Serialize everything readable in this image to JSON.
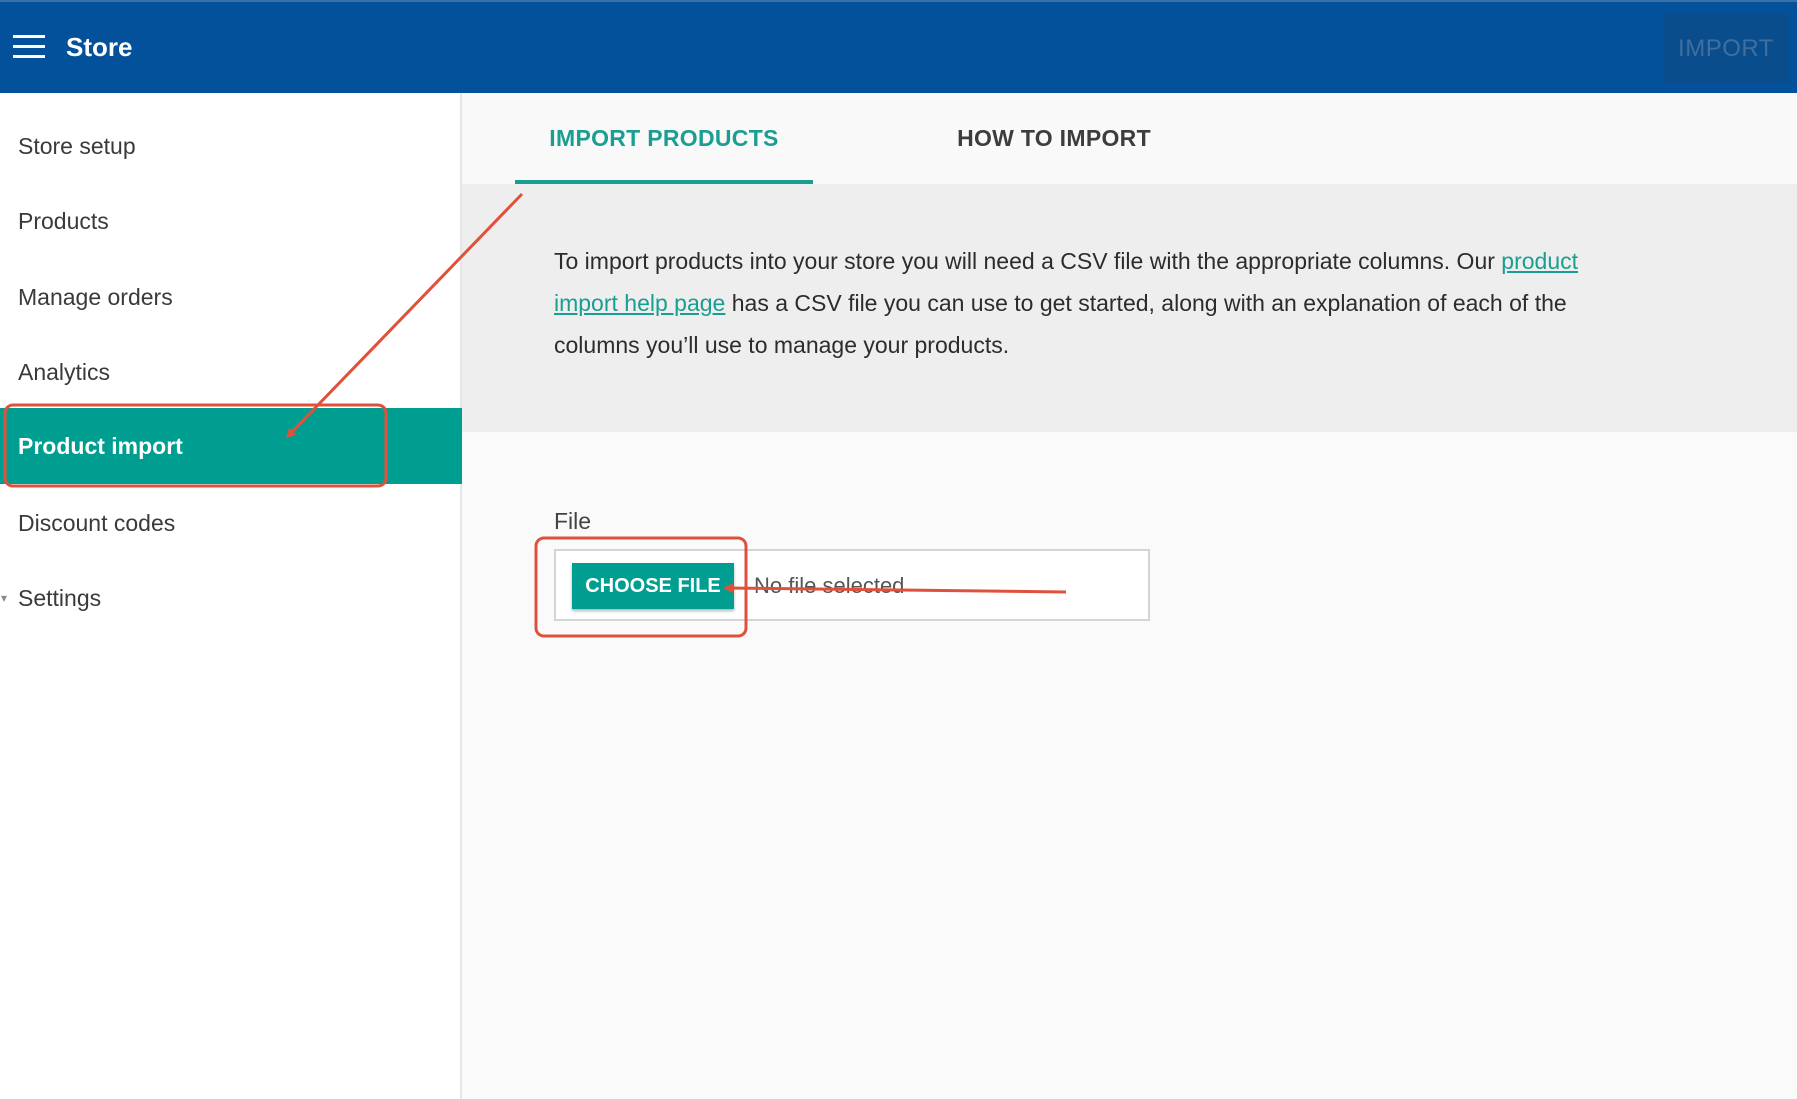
{
  "header": {
    "title": "Store",
    "import_label": "IMPORT"
  },
  "sidebar": {
    "items": [
      {
        "label": "Store setup"
      },
      {
        "label": "Products"
      },
      {
        "label": "Manage orders"
      },
      {
        "label": "Analytics"
      },
      {
        "label": "Product import",
        "active": true
      },
      {
        "label": "Discount codes"
      },
      {
        "label": "Settings"
      }
    ]
  },
  "tabs": [
    {
      "label": "IMPORT PRODUCTS",
      "active": true
    },
    {
      "label": "HOW TO IMPORT",
      "active": false
    }
  ],
  "info": {
    "text_before": "To import products into your store you will need a CSV file with the appropriate columns. Our ",
    "link_text": "product import help page",
    "text_after": " has a CSV file you can use to get started, along with an explanation of each of the columns you’ll use to manage your products."
  },
  "file_input": {
    "label": "File",
    "button_label": "CHOOSE FILE",
    "status": "No file selected"
  },
  "colors": {
    "header_bg": "#02519a",
    "accent": "#009e91",
    "annotation": "#e0513c"
  },
  "icons": {
    "menu": "hamburger-menu-icon",
    "expand": "caret-icon"
  }
}
